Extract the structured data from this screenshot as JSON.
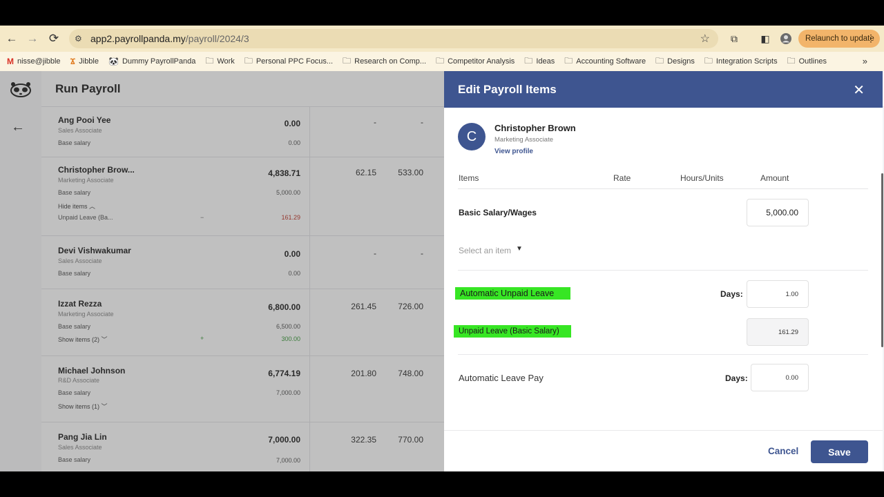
{
  "browser": {
    "url_host": "app2.payrollpanda.my",
    "url_path": "/payroll/2024/3",
    "relaunch_label": "Relaunch to update",
    "bookmarks": [
      {
        "label": "nisse@jibble",
        "icon": "gmail-icon"
      },
      {
        "label": "Jibble",
        "icon": "jibble-icon"
      },
      {
        "label": "Dummy PayrollPanda",
        "icon": "panda-icon"
      },
      {
        "label": "Work",
        "icon": "folder-icon"
      },
      {
        "label": "Personal PPC Focus...",
        "icon": "folder-icon"
      },
      {
        "label": "Research on Comp...",
        "icon": "folder-icon"
      },
      {
        "label": "Competitor Analysis",
        "icon": "folder-icon"
      },
      {
        "label": "Ideas",
        "icon": "folder-icon"
      },
      {
        "label": "Accounting Software",
        "icon": "folder-icon"
      },
      {
        "label": "Designs",
        "icon": "folder-icon"
      },
      {
        "label": "Integration Scripts",
        "icon": "folder-icon"
      },
      {
        "label": "Outlines",
        "icon": "folder-icon"
      }
    ]
  },
  "app": {
    "title": "Run Payroll"
  },
  "employees": [
    {
      "name": "Ang Pooi Yee",
      "role": "Sales Associate",
      "total": "0.00",
      "base_label": "Base salary",
      "base": "0.00",
      "col_a": "-",
      "col_b": "-"
    },
    {
      "name": "Christopher Brow...",
      "role": "Marketing Associate",
      "total": "4,838.71",
      "base_label": "Base salary",
      "base": "5,000.00",
      "col_a": "62.15",
      "col_b": "533.00",
      "toggle": "Hide items",
      "extra_label": "Unpaid Leave (Ba...",
      "extra_sign": "−",
      "extra_value": "161.29"
    },
    {
      "name": "Devi Vishwakumar",
      "role": "Sales Associate",
      "total": "0.00",
      "base_label": "Base salary",
      "base": "0.00",
      "col_a": "-",
      "col_b": "-"
    },
    {
      "name": "Izzat Rezza",
      "role": "Marketing Associate",
      "total": "6,800.00",
      "base_label": "Base salary",
      "base": "6,500.00",
      "col_a": "261.45",
      "col_b": "726.00",
      "toggle": "Show items (2)",
      "extra_sign": "+",
      "extra_value": "300.00"
    },
    {
      "name": "Michael Johnson",
      "role": "R&D Associate",
      "total": "6,774.19",
      "base_label": "Base salary",
      "base": "7,000.00",
      "col_a": "201.80",
      "col_b": "748.00",
      "toggle": "Show items (1)"
    },
    {
      "name": "Pang Jia Lin",
      "role": "Sales Associate",
      "total": "7,000.00",
      "base_label": "Base salary",
      "base": "7,000.00",
      "col_a": "322.35",
      "col_b": "770.00"
    }
  ],
  "drawer": {
    "title": "Edit Payroll Items",
    "avatar_initial": "C",
    "person_name": "Christopher Brown",
    "person_role": "Marketing Associate",
    "view_profile": "View profile",
    "headers": {
      "items": "Items",
      "rate": "Rate",
      "hours": "Hours/Units",
      "amount": "Amount"
    },
    "basic_salary_label": "Basic Salary/Wages",
    "basic_salary_value": "5,000.00",
    "select_placeholder": "Select an item",
    "auto_unpaid_label": "Automatic Unpaid Leave",
    "days_label": "Days:",
    "auto_unpaid_days": "1.00",
    "unpaid_leave_label": "Unpaid Leave (Basic Salary)",
    "unpaid_leave_value": "161.29",
    "auto_leave_pay_label": "Automatic Leave Pay",
    "auto_leave_pay_days": "0.00",
    "cancel_label": "Cancel",
    "save_label": "Save"
  },
  "colors": {
    "brand": "#3e5590",
    "highlight": "#37e624",
    "negative": "#c0392b",
    "positive": "#3a9a3a"
  }
}
